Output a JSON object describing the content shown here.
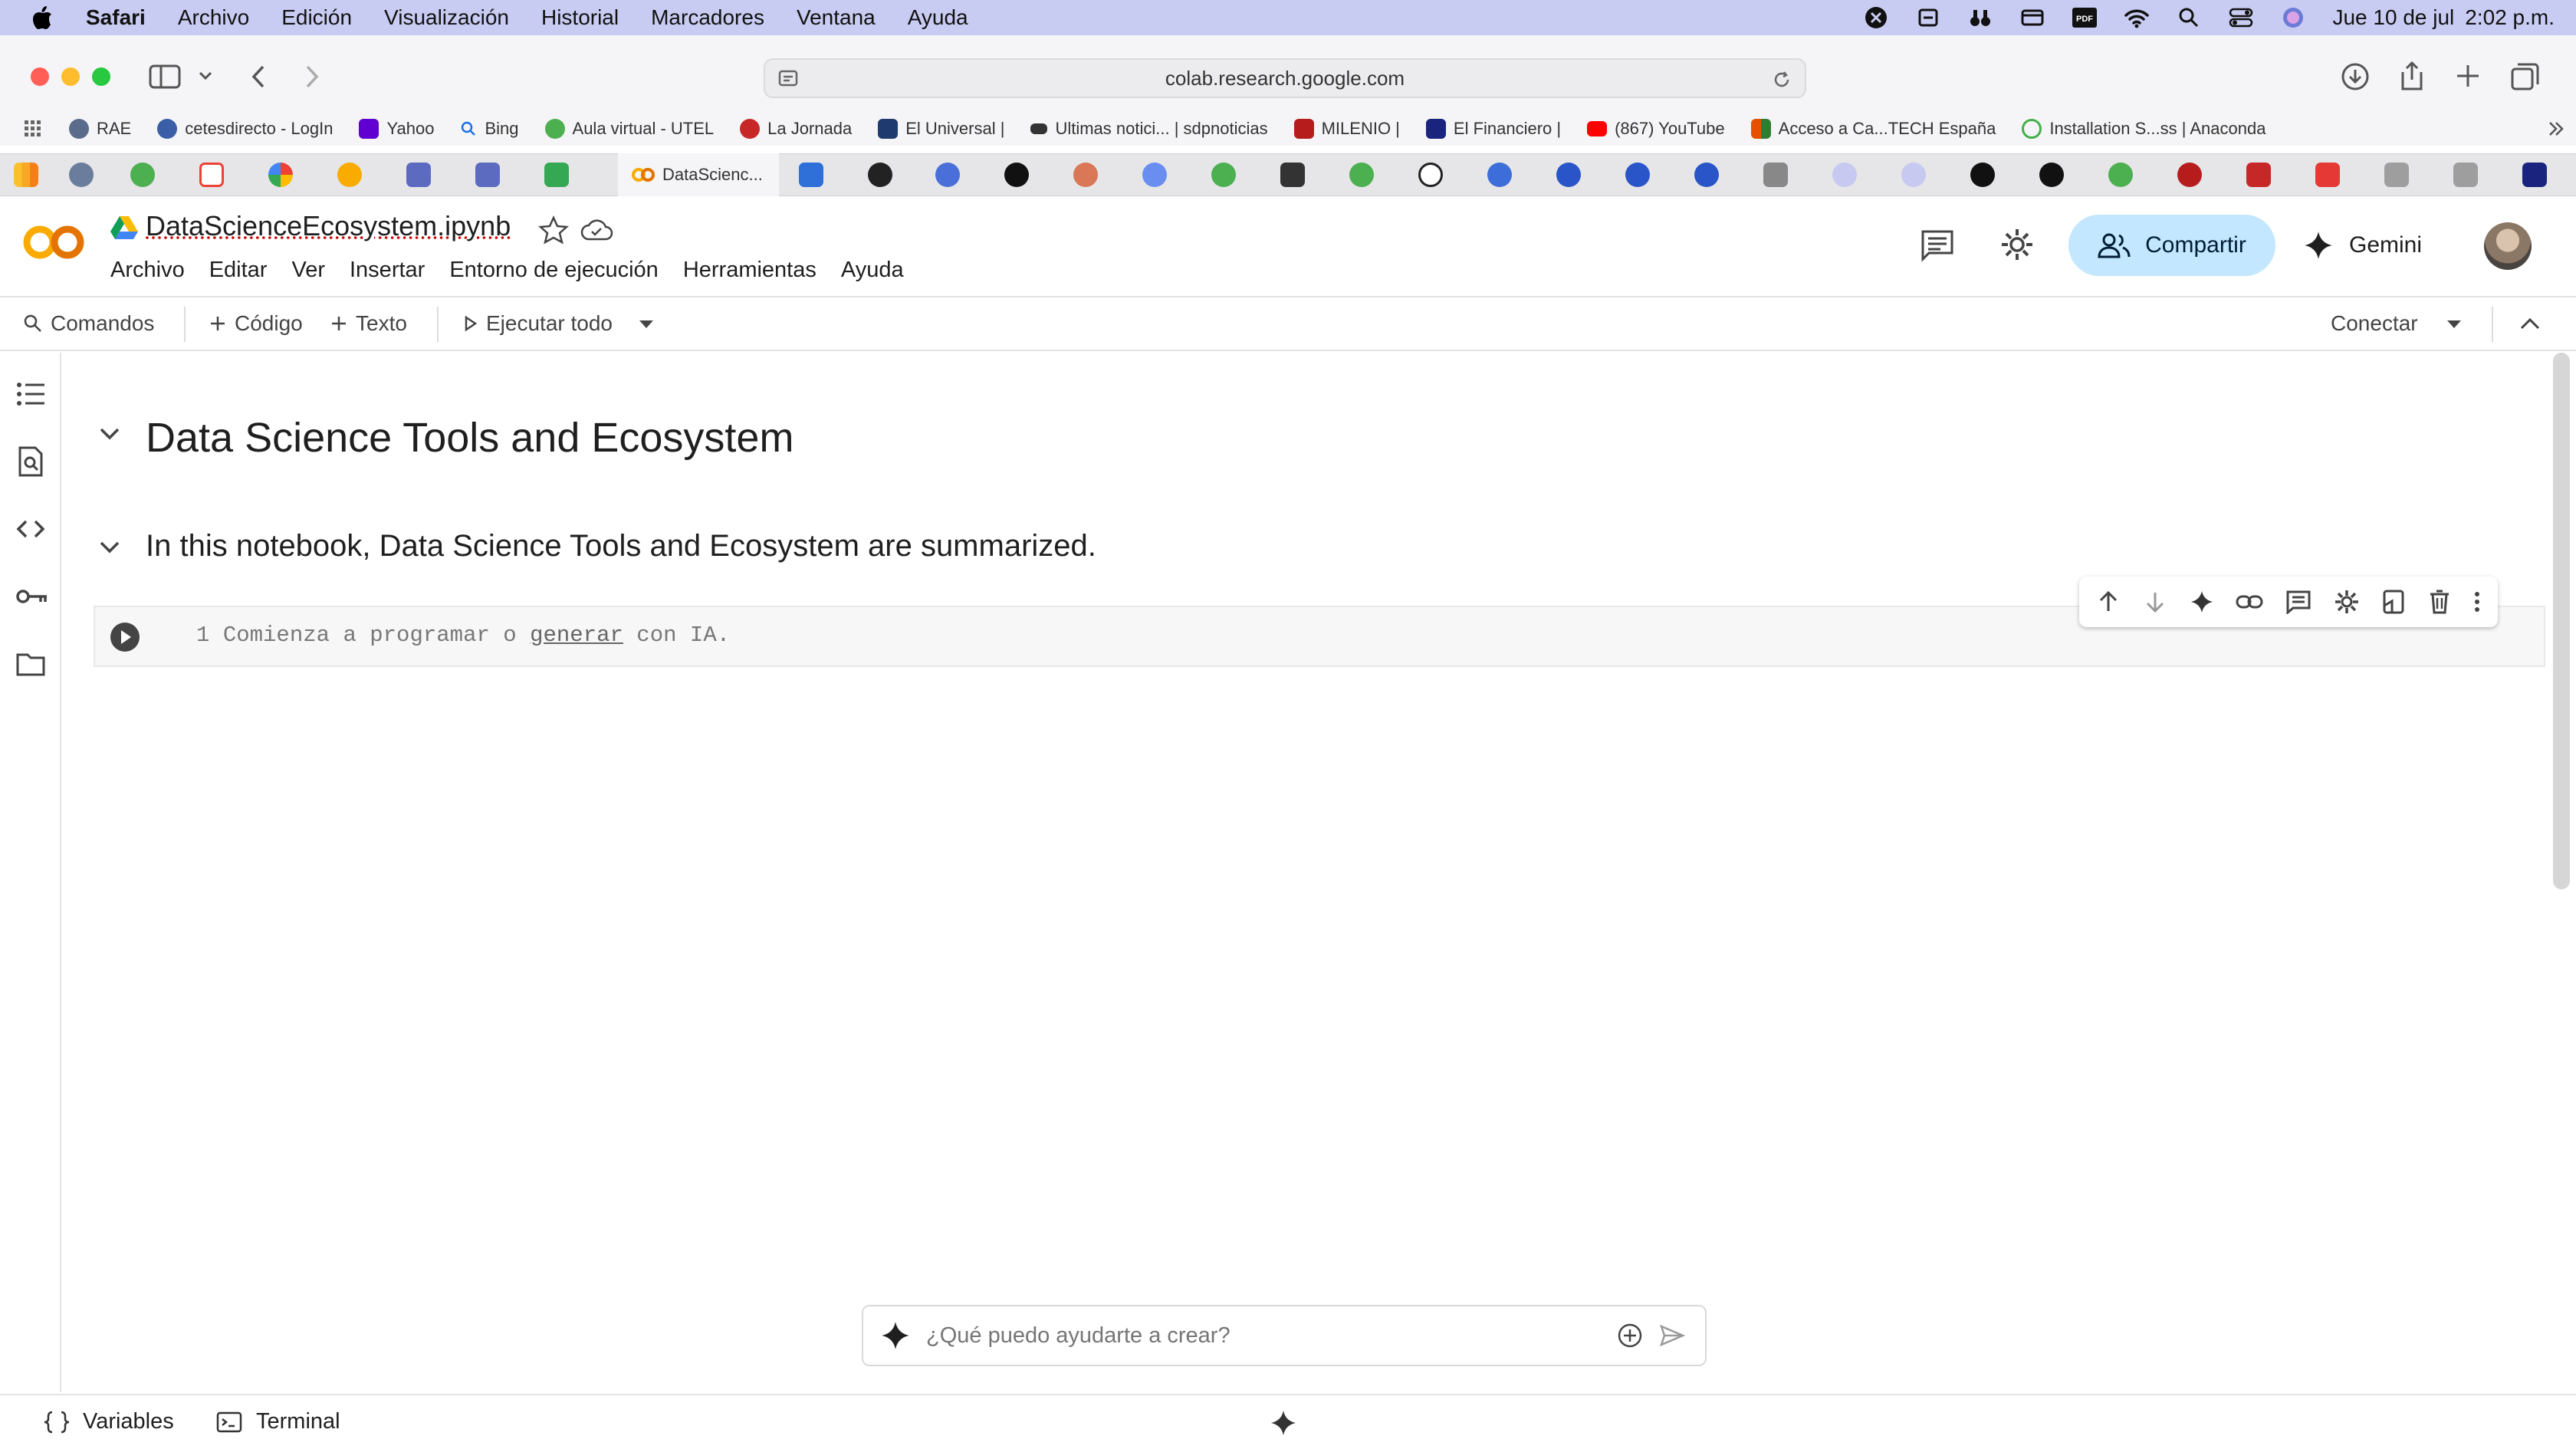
{
  "menubar": {
    "app": "Safari",
    "items": [
      "Archivo",
      "Edición",
      "Visualización",
      "Historial",
      "Marcadores",
      "Ventana",
      "Ayuda"
    ],
    "date": "Jue 10 de jul",
    "time": "2:02 p.m."
  },
  "safari": {
    "url": "colab.research.google.com"
  },
  "favorites": [
    {
      "label": "RAE",
      "color": "#5a6b8c"
    },
    {
      "label": "cetesdirecto - LogIn",
      "color": "#3a5ea8"
    },
    {
      "label": "Yahoo",
      "color": "#6001d2"
    },
    {
      "label": "Bing",
      "color": "#1b72e8"
    },
    {
      "label": "Aula virtual - UTEL",
      "color": "#4caf50"
    },
    {
      "label": "La Jornada",
      "color": "#c62828"
    },
    {
      "label": "El Universal |",
      "color": "#1e3a6e"
    },
    {
      "label": "Ultimas notici... | sdpnoticias",
      "color": "#333333"
    },
    {
      "label": "MILENIO |",
      "color": "#b71c1c"
    },
    {
      "label": "El Financiero |",
      "color": "#1a237e"
    },
    {
      "label": "(867) YouTube",
      "color": "#ff0000"
    },
    {
      "label": "Acceso a Ca...TECH España",
      "color": "#e65100"
    },
    {
      "label": "Installation S...ss | Anaconda",
      "color": "#43b049"
    }
  ],
  "active_tab": {
    "label": "DataScienc..."
  },
  "colab": {
    "notebook_title": "DataScienceEcosystem.ipynb",
    "menu": [
      "Archivo",
      "Editar",
      "Ver",
      "Insertar",
      "Entorno de ejecución",
      "Herramientas",
      "Ayuda"
    ],
    "share_label": "Compartir",
    "gemini_label": "Gemini",
    "toolbar": {
      "commands_label": "Comandos",
      "code_label": "Código",
      "text_label": "Texto",
      "run_all_label": "Ejecutar todo",
      "connect_label": "Conectar"
    }
  },
  "notebook": {
    "heading1": "Data Science Tools and Ecosystem",
    "heading2": "In this notebook, Data Science Tools and Ecosystem are summarized.",
    "code_cell": {
      "line_number": "1",
      "placeholder_before": "Comienza a programar o ",
      "placeholder_link": "generar",
      "placeholder_after": " con IA."
    }
  },
  "prompt": {
    "placeholder": "¿Qué puedo ayudarte a crear?"
  },
  "statusbar": {
    "variables_label": "Variables",
    "terminal_label": "Terminal"
  },
  "colors": {
    "accent": "#c2e7ff",
    "menubar_bg": "#c9ccf2",
    "colab_orange": "#f9ab00"
  }
}
